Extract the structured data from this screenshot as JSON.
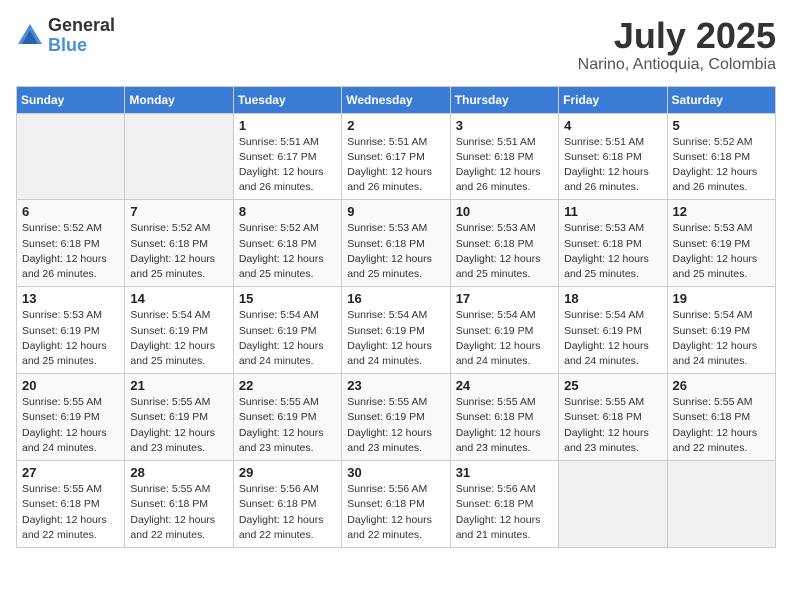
{
  "header": {
    "logo_general": "General",
    "logo_blue": "Blue",
    "month": "July 2025",
    "location": "Narino, Antioquia, Colombia"
  },
  "days_of_week": [
    "Sunday",
    "Monday",
    "Tuesday",
    "Wednesday",
    "Thursday",
    "Friday",
    "Saturday"
  ],
  "weeks": [
    [
      {
        "day": "",
        "empty": true
      },
      {
        "day": "",
        "empty": true
      },
      {
        "day": "1",
        "sunrise": "Sunrise: 5:51 AM",
        "sunset": "Sunset: 6:17 PM",
        "daylight": "Daylight: 12 hours and 26 minutes."
      },
      {
        "day": "2",
        "sunrise": "Sunrise: 5:51 AM",
        "sunset": "Sunset: 6:17 PM",
        "daylight": "Daylight: 12 hours and 26 minutes."
      },
      {
        "day": "3",
        "sunrise": "Sunrise: 5:51 AM",
        "sunset": "Sunset: 6:18 PM",
        "daylight": "Daylight: 12 hours and 26 minutes."
      },
      {
        "day": "4",
        "sunrise": "Sunrise: 5:51 AM",
        "sunset": "Sunset: 6:18 PM",
        "daylight": "Daylight: 12 hours and 26 minutes."
      },
      {
        "day": "5",
        "sunrise": "Sunrise: 5:52 AM",
        "sunset": "Sunset: 6:18 PM",
        "daylight": "Daylight: 12 hours and 26 minutes."
      }
    ],
    [
      {
        "day": "6",
        "sunrise": "Sunrise: 5:52 AM",
        "sunset": "Sunset: 6:18 PM",
        "daylight": "Daylight: 12 hours and 26 minutes."
      },
      {
        "day": "7",
        "sunrise": "Sunrise: 5:52 AM",
        "sunset": "Sunset: 6:18 PM",
        "daylight": "Daylight: 12 hours and 25 minutes."
      },
      {
        "day": "8",
        "sunrise": "Sunrise: 5:52 AM",
        "sunset": "Sunset: 6:18 PM",
        "daylight": "Daylight: 12 hours and 25 minutes."
      },
      {
        "day": "9",
        "sunrise": "Sunrise: 5:53 AM",
        "sunset": "Sunset: 6:18 PM",
        "daylight": "Daylight: 12 hours and 25 minutes."
      },
      {
        "day": "10",
        "sunrise": "Sunrise: 5:53 AM",
        "sunset": "Sunset: 6:18 PM",
        "daylight": "Daylight: 12 hours and 25 minutes."
      },
      {
        "day": "11",
        "sunrise": "Sunrise: 5:53 AM",
        "sunset": "Sunset: 6:18 PM",
        "daylight": "Daylight: 12 hours and 25 minutes."
      },
      {
        "day": "12",
        "sunrise": "Sunrise: 5:53 AM",
        "sunset": "Sunset: 6:19 PM",
        "daylight": "Daylight: 12 hours and 25 minutes."
      }
    ],
    [
      {
        "day": "13",
        "sunrise": "Sunrise: 5:53 AM",
        "sunset": "Sunset: 6:19 PM",
        "daylight": "Daylight: 12 hours and 25 minutes."
      },
      {
        "day": "14",
        "sunrise": "Sunrise: 5:54 AM",
        "sunset": "Sunset: 6:19 PM",
        "daylight": "Daylight: 12 hours and 25 minutes."
      },
      {
        "day": "15",
        "sunrise": "Sunrise: 5:54 AM",
        "sunset": "Sunset: 6:19 PM",
        "daylight": "Daylight: 12 hours and 24 minutes."
      },
      {
        "day": "16",
        "sunrise": "Sunrise: 5:54 AM",
        "sunset": "Sunset: 6:19 PM",
        "daylight": "Daylight: 12 hours and 24 minutes."
      },
      {
        "day": "17",
        "sunrise": "Sunrise: 5:54 AM",
        "sunset": "Sunset: 6:19 PM",
        "daylight": "Daylight: 12 hours and 24 minutes."
      },
      {
        "day": "18",
        "sunrise": "Sunrise: 5:54 AM",
        "sunset": "Sunset: 6:19 PM",
        "daylight": "Daylight: 12 hours and 24 minutes."
      },
      {
        "day": "19",
        "sunrise": "Sunrise: 5:54 AM",
        "sunset": "Sunset: 6:19 PM",
        "daylight": "Daylight: 12 hours and 24 minutes."
      }
    ],
    [
      {
        "day": "20",
        "sunrise": "Sunrise: 5:55 AM",
        "sunset": "Sunset: 6:19 PM",
        "daylight": "Daylight: 12 hours and 24 minutes."
      },
      {
        "day": "21",
        "sunrise": "Sunrise: 5:55 AM",
        "sunset": "Sunset: 6:19 PM",
        "daylight": "Daylight: 12 hours and 23 minutes."
      },
      {
        "day": "22",
        "sunrise": "Sunrise: 5:55 AM",
        "sunset": "Sunset: 6:19 PM",
        "daylight": "Daylight: 12 hours and 23 minutes."
      },
      {
        "day": "23",
        "sunrise": "Sunrise: 5:55 AM",
        "sunset": "Sunset: 6:19 PM",
        "daylight": "Daylight: 12 hours and 23 minutes."
      },
      {
        "day": "24",
        "sunrise": "Sunrise: 5:55 AM",
        "sunset": "Sunset: 6:18 PM",
        "daylight": "Daylight: 12 hours and 23 minutes."
      },
      {
        "day": "25",
        "sunrise": "Sunrise: 5:55 AM",
        "sunset": "Sunset: 6:18 PM",
        "daylight": "Daylight: 12 hours and 23 minutes."
      },
      {
        "day": "26",
        "sunrise": "Sunrise: 5:55 AM",
        "sunset": "Sunset: 6:18 PM",
        "daylight": "Daylight: 12 hours and 22 minutes."
      }
    ],
    [
      {
        "day": "27",
        "sunrise": "Sunrise: 5:55 AM",
        "sunset": "Sunset: 6:18 PM",
        "daylight": "Daylight: 12 hours and 22 minutes."
      },
      {
        "day": "28",
        "sunrise": "Sunrise: 5:55 AM",
        "sunset": "Sunset: 6:18 PM",
        "daylight": "Daylight: 12 hours and 22 minutes."
      },
      {
        "day": "29",
        "sunrise": "Sunrise: 5:56 AM",
        "sunset": "Sunset: 6:18 PM",
        "daylight": "Daylight: 12 hours and 22 minutes."
      },
      {
        "day": "30",
        "sunrise": "Sunrise: 5:56 AM",
        "sunset": "Sunset: 6:18 PM",
        "daylight": "Daylight: 12 hours and 22 minutes."
      },
      {
        "day": "31",
        "sunrise": "Sunrise: 5:56 AM",
        "sunset": "Sunset: 6:18 PM",
        "daylight": "Daylight: 12 hours and 21 minutes."
      },
      {
        "day": "",
        "empty": true
      },
      {
        "day": "",
        "empty": true
      }
    ]
  ]
}
